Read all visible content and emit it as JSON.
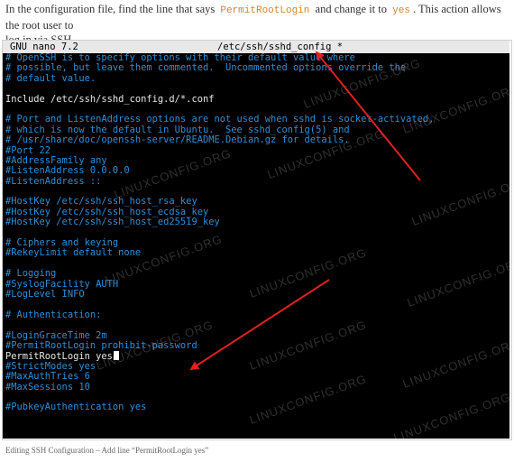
{
  "intro": {
    "line1_a": "In the configuration file, find the line that says",
    "code1": "PermitRootLogin",
    "line1_b": "and change it to",
    "code2": "yes",
    "line1_c": ". This action allows the root user to",
    "line2": "log in via SSH."
  },
  "nano": {
    "app_label": "GNU nano 7.2",
    "file_title": "/etc/ssh/sshd_config *"
  },
  "lines": [
    {
      "text": "# OpenSSH is to specify options with their default value where",
      "type": "comment"
    },
    {
      "text": "# possible, but leave them commented.  Uncommented options override the",
      "type": "comment"
    },
    {
      "text": "# default value.",
      "type": "comment"
    },
    {
      "text": "",
      "type": "plain"
    },
    {
      "text": "Include /etc/ssh/sshd_config.d/*.conf",
      "type": "plain"
    },
    {
      "text": "",
      "type": "plain"
    },
    {
      "text": "# Port and ListenAddress options are not used when sshd is socket-activated,",
      "type": "comment"
    },
    {
      "text": "# which is now the default in Ubuntu.  See sshd_config(5) and",
      "type": "comment"
    },
    {
      "text": "# /usr/share/doc/openssh-server/README.Debian.gz for details.",
      "type": "comment"
    },
    {
      "text": "#Port 22",
      "type": "comment"
    },
    {
      "text": "#AddressFamily any",
      "type": "comment"
    },
    {
      "text": "#ListenAddress 0.0.0.0",
      "type": "comment"
    },
    {
      "text": "#ListenAddress ::",
      "type": "comment"
    },
    {
      "text": "",
      "type": "plain"
    },
    {
      "text": "#HostKey /etc/ssh/ssh_host_rsa_key",
      "type": "comment"
    },
    {
      "text": "#HostKey /etc/ssh/ssh_host_ecdsa_key",
      "type": "comment"
    },
    {
      "text": "#HostKey /etc/ssh/ssh_host_ed25519_key",
      "type": "comment"
    },
    {
      "text": "",
      "type": "plain"
    },
    {
      "text": "# Ciphers and keying",
      "type": "comment"
    },
    {
      "text": "#RekeyLimit default none",
      "type": "comment"
    },
    {
      "text": "",
      "type": "plain"
    },
    {
      "text": "# Logging",
      "type": "comment"
    },
    {
      "text": "#SyslogFacility AUTH",
      "type": "comment"
    },
    {
      "text": "#LogLevel INFO",
      "type": "comment"
    },
    {
      "text": "",
      "type": "plain"
    },
    {
      "text": "# Authentication:",
      "type": "comment"
    },
    {
      "text": "",
      "type": "plain"
    },
    {
      "text": "#LoginGraceTime 2m",
      "type": "comment"
    },
    {
      "text": "#PermitRootLogin prohibit-password",
      "type": "comment"
    },
    {
      "text": "PermitRootLogin yes",
      "type": "plain",
      "cursor": true
    },
    {
      "text": "#StrictModes yes",
      "type": "comment"
    },
    {
      "text": "#MaxAuthTries 6",
      "type": "comment"
    },
    {
      "text": "#MaxSessions 10",
      "type": "comment"
    },
    {
      "text": "",
      "type": "plain"
    },
    {
      "text": "#PubkeyAuthentication yes",
      "type": "comment"
    }
  ],
  "watermark_text": "LINUXCONFIG.ORG",
  "caption": "Editing SSH Configuration – Add line “PermitRootLogin yes”",
  "colors": {
    "comment": "#2e8fd6",
    "plain": "#e9e9e9",
    "arrow": "#e02020",
    "code_highlight": "#d9822b"
  }
}
